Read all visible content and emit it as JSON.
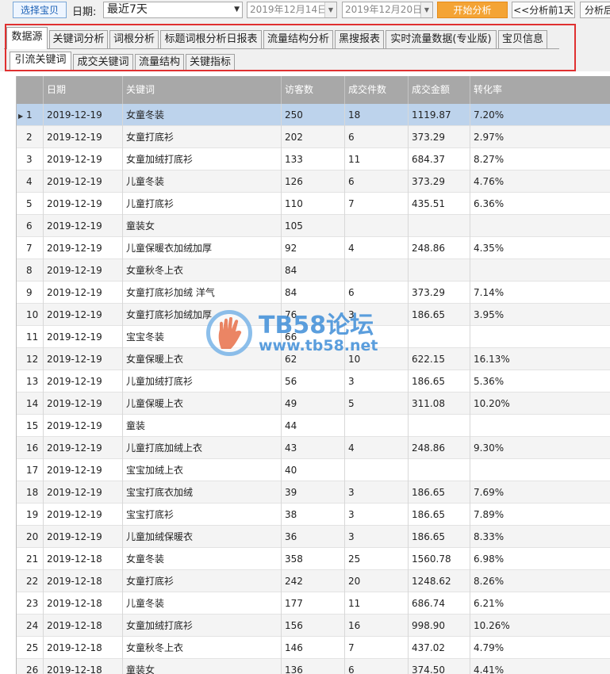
{
  "toolbar": {
    "select_item_label": "选择宝贝",
    "date_label": "日期:",
    "range_value": "最近7天",
    "start_date": "2019年12月14日",
    "end_date": "2019年12月20日",
    "start_analysis_label": "开始分析",
    "prev_day_label": "<<分析前1天",
    "next_day_label": "分析后"
  },
  "tabs": [
    {
      "label": "数据源",
      "active": true
    },
    {
      "label": "关键词分析"
    },
    {
      "label": "词根分析"
    },
    {
      "label": "标题词根分析日报表"
    },
    {
      "label": "流量结构分析"
    },
    {
      "label": "黑搜报表"
    },
    {
      "label": "实时流量数据(专业版)"
    },
    {
      "label": "宝贝信息"
    }
  ],
  "subtabs": [
    {
      "label": "引流关键词",
      "active": true
    },
    {
      "label": "成交关键词"
    },
    {
      "label": "流量结构"
    },
    {
      "label": "关键指标"
    }
  ],
  "table": {
    "columns": [
      "日期",
      "关键词",
      "访客数",
      "成交件数",
      "成交金额",
      "转化率"
    ],
    "rows": [
      [
        "1",
        "2019-12-19",
        "女童冬装",
        "250",
        "18",
        "1119.87",
        "7.20%"
      ],
      [
        "2",
        "2019-12-19",
        "女童打底衫",
        "202",
        "6",
        "373.29",
        "2.97%"
      ],
      [
        "3",
        "2019-12-19",
        "女童加绒打底衫",
        "133",
        "11",
        "684.37",
        "8.27%"
      ],
      [
        "4",
        "2019-12-19",
        "儿童冬装",
        "126",
        "6",
        "373.29",
        "4.76%"
      ],
      [
        "5",
        "2019-12-19",
        "儿童打底衫",
        "110",
        "7",
        "435.51",
        "6.36%"
      ],
      [
        "6",
        "2019-12-19",
        "童装女",
        "105",
        "",
        "",
        ""
      ],
      [
        "7",
        "2019-12-19",
        "儿童保暖衣加绒加厚",
        "92",
        "4",
        "248.86",
        "4.35%"
      ],
      [
        "8",
        "2019-12-19",
        "女童秋冬上衣",
        "84",
        "",
        "",
        ""
      ],
      [
        "9",
        "2019-12-19",
        "女童打底衫加绒 洋气",
        "84",
        "6",
        "373.29",
        "7.14%"
      ],
      [
        "10",
        "2019-12-19",
        "女童打底衫加绒加厚",
        "76",
        "3",
        "186.65",
        "3.95%"
      ],
      [
        "11",
        "2019-12-19",
        "宝宝冬装",
        "66",
        "",
        "",
        ""
      ],
      [
        "12",
        "2019-12-19",
        "女童保暖上衣",
        "62",
        "10",
        "622.15",
        "16.13%"
      ],
      [
        "13",
        "2019-12-19",
        "儿童加绒打底衫",
        "56",
        "3",
        "186.65",
        "5.36%"
      ],
      [
        "14",
        "2019-12-19",
        "儿童保暖上衣",
        "49",
        "5",
        "311.08",
        "10.20%"
      ],
      [
        "15",
        "2019-12-19",
        "童装",
        "44",
        "",
        "",
        ""
      ],
      [
        "16",
        "2019-12-19",
        "儿童打底加绒上衣",
        "43",
        "4",
        "248.86",
        "9.30%"
      ],
      [
        "17",
        "2019-12-19",
        "宝宝加绒上衣",
        "40",
        "",
        "",
        ""
      ],
      [
        "18",
        "2019-12-19",
        "宝宝打底衣加绒",
        "39",
        "3",
        "186.65",
        "7.69%"
      ],
      [
        "19",
        "2019-12-19",
        "宝宝打底衫",
        "38",
        "3",
        "186.65",
        "7.89%"
      ],
      [
        "20",
        "2019-12-19",
        "儿童加绒保暖衣",
        "36",
        "3",
        "186.65",
        "8.33%"
      ],
      [
        "21",
        "2019-12-18",
        "女童冬装",
        "358",
        "25",
        "1560.78",
        "6.98%"
      ],
      [
        "22",
        "2019-12-18",
        "女童打底衫",
        "242",
        "20",
        "1248.62",
        "8.26%"
      ],
      [
        "23",
        "2019-12-18",
        "儿童冬装",
        "177",
        "11",
        "686.74",
        "6.21%"
      ],
      [
        "24",
        "2019-12-18",
        "女童加绒打底衫",
        "156",
        "16",
        "998.90",
        "10.26%"
      ],
      [
        "25",
        "2019-12-18",
        "女童秋冬上衣",
        "146",
        "7",
        "437.02",
        "4.79%"
      ],
      [
        "26",
        "2019-12-18",
        "童装女",
        "136",
        "6",
        "374.50",
        "4.41%"
      ]
    ]
  },
  "watermark": {
    "brand": "TB58论坛",
    "url": "www.tb58.net"
  },
  "colors": {
    "accent_orange": "#f4a435",
    "selected_row": "#bdd3ec",
    "header_gray": "#a8a8a8",
    "highlight_red": "#e03030",
    "watermark_blue": "#3f8ed8"
  }
}
